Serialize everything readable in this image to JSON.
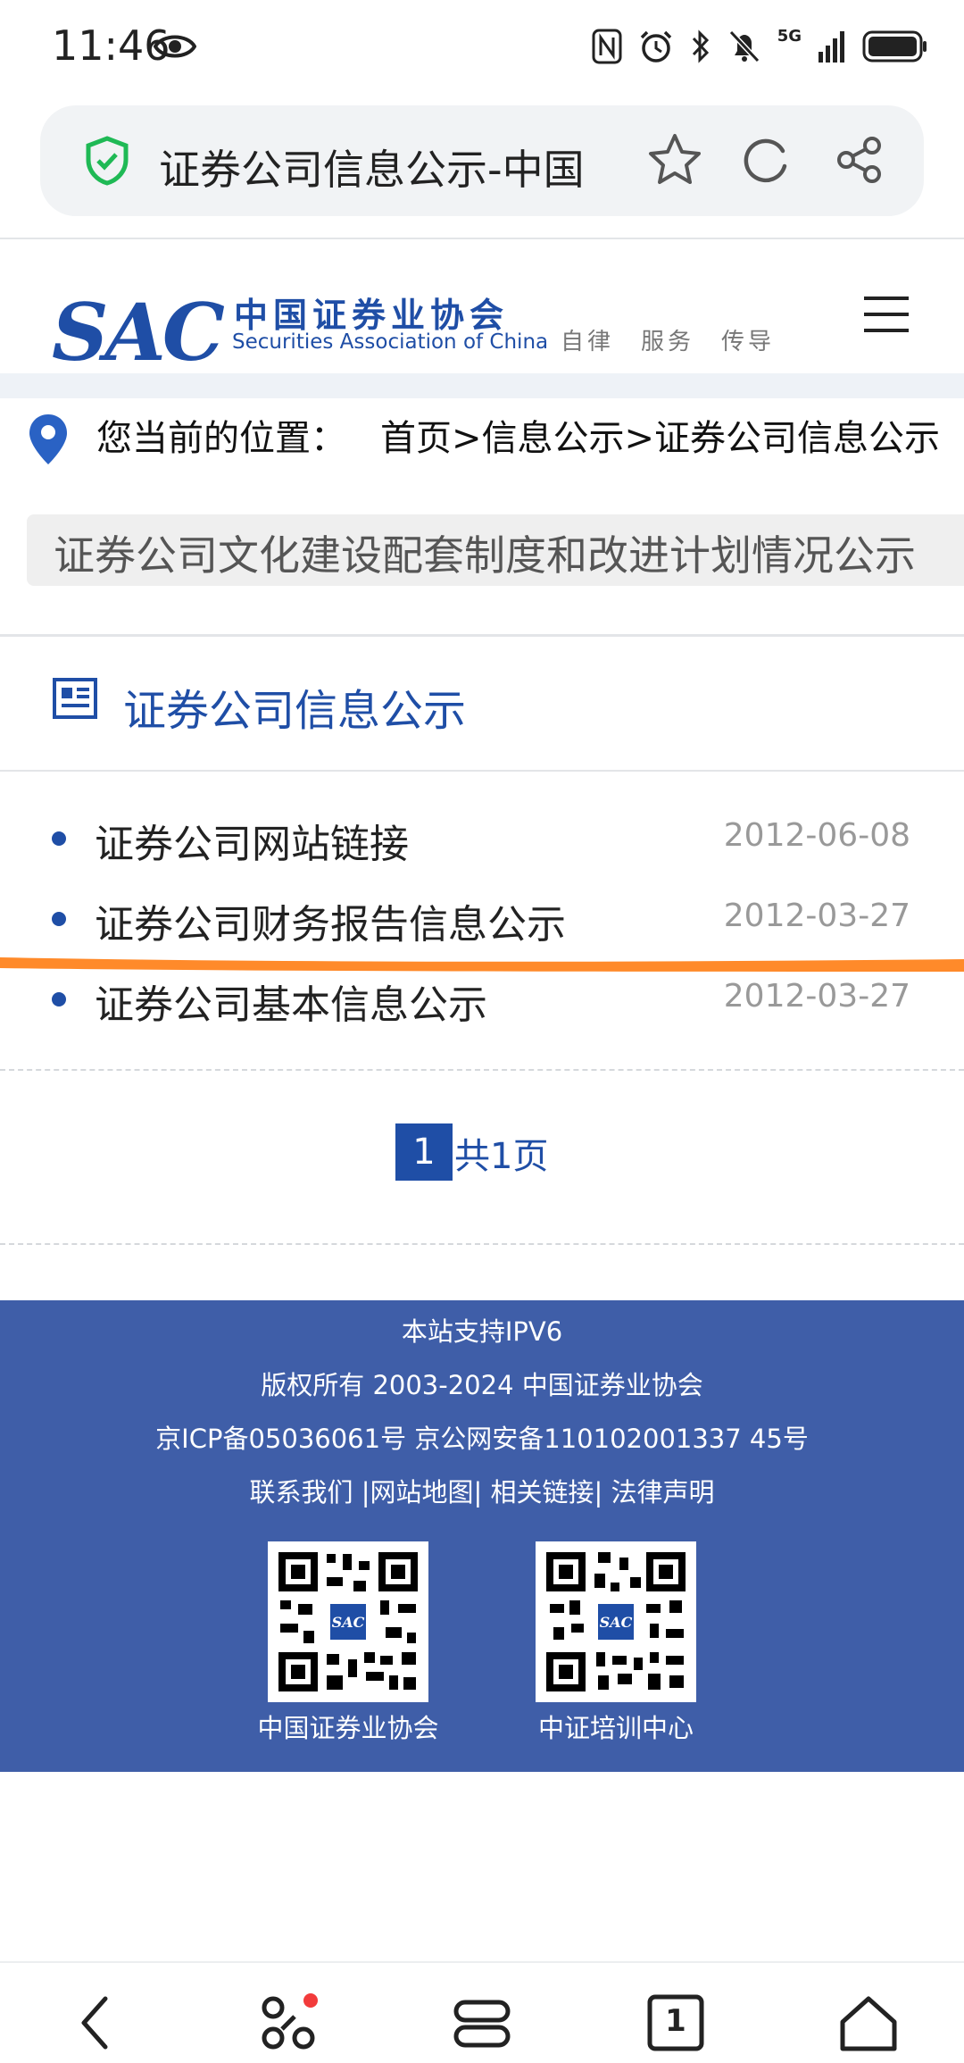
{
  "status_bar": {
    "time": "11:46",
    "network": "5G"
  },
  "browser": {
    "title": "证券公司信息公示-中国"
  },
  "site": {
    "logo_text": "SAC",
    "logo_cn": "中国证券业协会",
    "logo_en": "Securities Association of China",
    "slogan": "自律　服务　传导"
  },
  "breadcrumb": {
    "label": "您当前的位置：",
    "path": "首页>信息公示>证券公司信息公示"
  },
  "notice": {
    "text": "证券公司文化建设配套制度和改进计划情况公示"
  },
  "section": {
    "title": "证券公司信息公示"
  },
  "list": [
    {
      "title": "证券公司网站链接",
      "date": "2012-06-08"
    },
    {
      "title": "证券公司财务报告信息公示",
      "date": "2012-03-27"
    },
    {
      "title": "证券公司基本信息公示",
      "date": "2012-03-27"
    }
  ],
  "pagination": {
    "current": "1",
    "total_label": "共1页"
  },
  "footer": {
    "ipv6": "本站支持IPV6",
    "copyright": "版权所有 2003-2024 中国证券业协会",
    "icp": "京ICP备05036061号 京公网安备110102001337 45号",
    "links": "联系我们 |网站地图| 相关链接| 法律声明",
    "qr": [
      {
        "label": "中国证券业协会"
      },
      {
        "label": "中证培训中心"
      }
    ]
  },
  "nav": {
    "tab_count": "1"
  },
  "colors": {
    "brand": "#1f4ea6",
    "footer": "#3f5ea8",
    "highlight": "#ff8a2a"
  }
}
